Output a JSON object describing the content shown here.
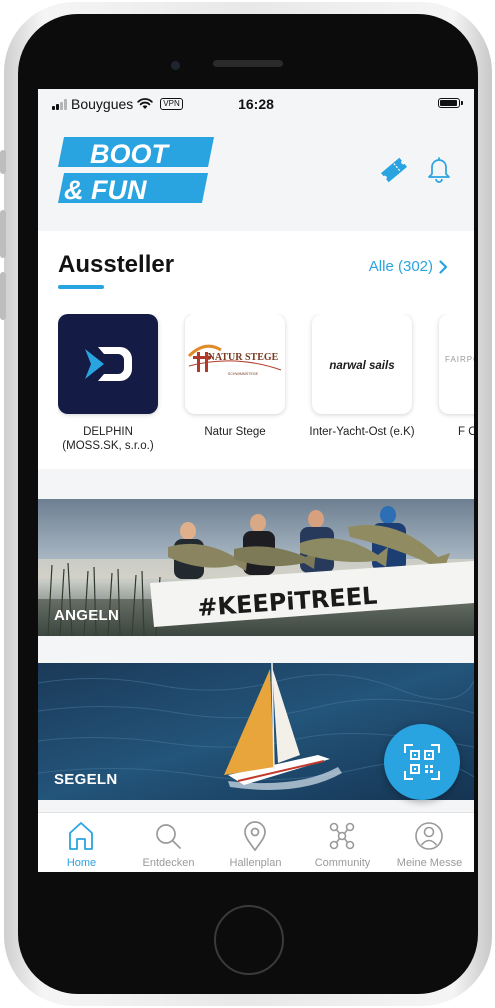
{
  "status_bar": {
    "carrier": "Bouygues",
    "vpn": "VPN",
    "time": "16:28"
  },
  "header": {
    "logo_line1": "BOOT",
    "logo_line2": "& FUN",
    "brand_color": "#2aa4e0",
    "icons": [
      "ticket-icon",
      "bell-icon"
    ]
  },
  "exhibitors": {
    "title": "Aussteller",
    "see_all": "Alle (302)",
    "items": [
      {
        "name": "DELPHIN (MOSS.SK, s.r.o.)",
        "logo_text": ""
      },
      {
        "name": "Natur Stege",
        "logo_text": "NATUR STEGE",
        "logo_sub": "SCHWIMMSTEGE"
      },
      {
        "name": "Inter-Yacht-Ost (e.K)",
        "logo_text": "narwal sails"
      },
      {
        "name": "F Out",
        "logo_text": "FAIRPO"
      }
    ]
  },
  "banners": [
    {
      "label": "ANGELN",
      "overlay_text": "#KEEPiTREEL"
    },
    {
      "label": "SEGELN"
    }
  ],
  "fab": {
    "icon": "qr-code-icon"
  },
  "tabs": [
    {
      "label": "Home",
      "icon": "home-icon",
      "active": true
    },
    {
      "label": "Entdecken",
      "icon": "search-icon",
      "active": false
    },
    {
      "label": "Hallenplan",
      "icon": "location-pin-icon",
      "active": false
    },
    {
      "label": "Community",
      "icon": "network-icon",
      "active": false
    },
    {
      "label": "Meine Messe",
      "icon": "profile-icon",
      "active": false
    }
  ]
}
